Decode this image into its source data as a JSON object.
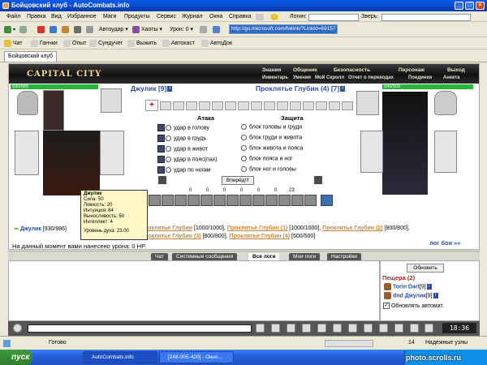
{
  "window": {
    "title": "Бойцовский клуб - AutoCombats.info"
  },
  "menu": {
    "items": [
      "Файл",
      "Правка",
      "Вид",
      "Избранное",
      "Маги",
      "Продукты",
      "Сервис",
      "Журнал",
      "Окна",
      "Справка"
    ],
    "login_label": "Логин:",
    "pet_label": "Зверь:"
  },
  "toolbar": {
    "autoguard": "Автоудар",
    "khaoty": "Хаоты",
    "uron": "Урон: 0",
    "address": "http://go.microsoft.com/fwlink/?LinkId=69157"
  },
  "links": {
    "items": [
      "Чат",
      "Ганчки",
      "Опыт",
      "Сундучег",
      "Выжить",
      "Автокаст",
      "АвтоДок"
    ]
  },
  "tab": {
    "label": "Бойцовский клуб"
  },
  "game": {
    "logo": "CAPITAL CITY",
    "nav_top": [
      "Знания",
      "Общение",
      "Безопасность",
      "Персонаж",
      "Выход"
    ],
    "nav_bottom": [
      "Инвентарь",
      "Умения",
      "Мой Скролл",
      "Отчет о переводах",
      "Поединки",
      "Анкета"
    ],
    "player": {
      "hp": "930/986",
      "name": "Джулик",
      "level": "[9]"
    },
    "enemy": {
      "hp": "500/500",
      "name": "Проклятье Глубин (4)",
      "level": "[7]"
    },
    "attack_title": "Атака",
    "defense_title": "Защита",
    "attacks": [
      "удар в голову",
      "удар в грудь",
      "удар в живот",
      "удар в пояс(пах)",
      "удар по ногам"
    ],
    "defenses": [
      "блок головы и груди",
      "блок груди и живота",
      "блок живота и пояса",
      "блок пояса и ног",
      "блок ног и головы"
    ],
    "forward": "Вперёд!!!",
    "counters": [
      "0",
      "0",
      "0",
      "0",
      "0",
      "0",
      "23"
    ],
    "tooltip": {
      "name": "Джулик",
      "lines": [
        "Сила: 50",
        "Ловкость: 20",
        "Интуиция: 84",
        "Выносливость: 50",
        "Интеллект: 4",
        "",
        "Уровень духа: 23.00"
      ]
    },
    "opponents_line1": {
      "you": "Джулик",
      "you_hp": "[930/986]",
      "items": [
        {
          "name": "Проклятье Глубин",
          "hp": "[1000/1000]"
        },
        {
          "name": "Проклятье Глубин (1)",
          "hp": "[1000/1000]"
        },
        {
          "name": "Проклятье Глубин (2)",
          "hp": "[800/800]"
        }
      ]
    },
    "opponents_line2": {
      "items": [
        {
          "name": "Проклятье Глубин (3)",
          "hp": "[800/800]"
        },
        {
          "name": "Проклятье Глубин (4)",
          "hp": "[500/500]"
        }
      ],
      "log_link": "лог боя »»"
    },
    "damage_text": "На данный момент вами нанесено урона: 0 HP."
  },
  "chat_tabs": [
    "Чат",
    "Системные сообщения",
    "Все логи",
    "Мои логи",
    "Настройки"
  ],
  "side": {
    "update": "Обновить",
    "location": "Пещера (2)",
    "members": [
      {
        "name": "Torin Dart",
        "level": "[9]"
      },
      {
        "name": "dnd Джулик",
        "level": "[9]"
      }
    ],
    "auto_update": "Обновлять автомат."
  },
  "status": {
    "left": "Готово",
    "zone": "Надежные узлы",
    "count": "14"
  },
  "taskbar": {
    "start": "пуск",
    "tasks": [
      "AutoCombats.info",
      "[248-005-420] - Окно..."
    ],
    "clock": "18:36"
  },
  "watermark": "photo.scrolls.ru"
}
